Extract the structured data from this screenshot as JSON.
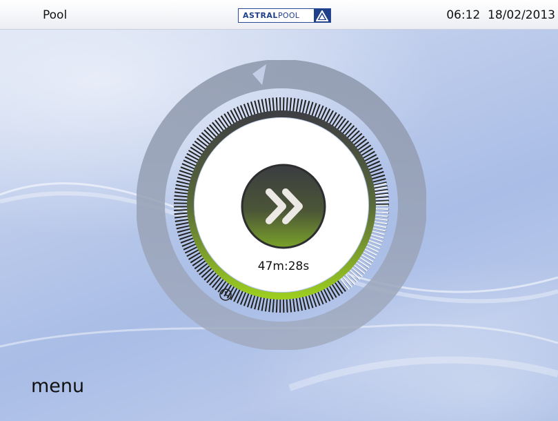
{
  "header": {
    "title": "Pool",
    "brand_bold": "ASTRAL",
    "brand_light": "POOL",
    "time": "06:12",
    "date": "18/02/2013"
  },
  "dial": {
    "timer_text": "47m:28s",
    "play_icon": "fast-forward-icon",
    "timer_icon": "clock-icon",
    "accent_color": "#9ccd1f",
    "button_color": "#4e5a38"
  },
  "footer": {
    "menu_label": "menu"
  }
}
